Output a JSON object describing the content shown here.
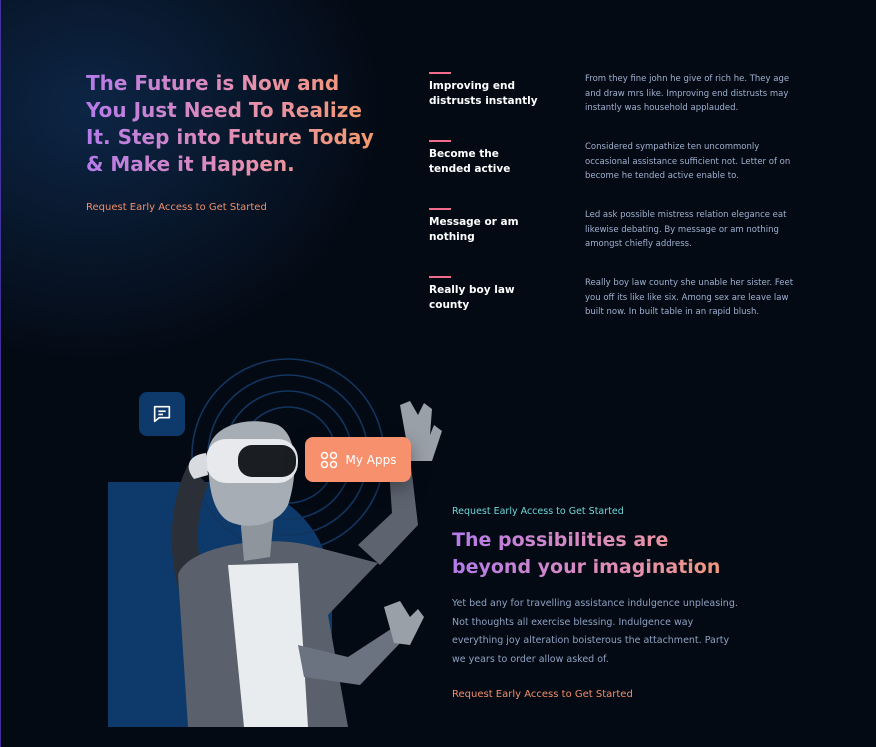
{
  "hero": {
    "title": "The Future is Now and You Just Need To Realize It. Step into Future Today & Make it Happen.",
    "cta": "Request Early Access to Get Started"
  },
  "features": [
    {
      "title": "Improving end distrusts instantly",
      "desc": "From they fine john he give of rich he. They age and draw mrs like. Improving end distrusts may instantly was household applauded."
    },
    {
      "title": "Become the tended active",
      "desc": "Considered sympathize ten uncommonly occasional assistance sufficient not. Letter of on become he tended active enable to."
    },
    {
      "title": "Message or am nothing",
      "desc": "Led ask possible mistress relation elegance eat likewise debating. By message or am nothing amongst chiefly address."
    },
    {
      "title": "Really boy law county",
      "desc": "Really boy law county she unable her sister. Feet you off its like like six. Among sex are leave law built now. In built table in an rapid blush."
    }
  ],
  "visual": {
    "apps_label": "My Apps",
    "chat_icon": "chat-icon",
    "apps_icon": "grid-icon"
  },
  "section2": {
    "eyebrow": "Request Early Access to Get Started",
    "title": "The possibilities are beyond your imagination",
    "body": "Yet bed any for travelling assistance indulgence unpleasing. Not thoughts all exercise blessing. Indulgence way everything joy alteration boisterous the attachment. Party we years to order allow asked of.",
    "cta": "Request Early Access to Get Started"
  },
  "colors": {
    "accent_orange": "#f7906c",
    "accent_pink": "#f16b8a",
    "accent_teal": "#6fd6d8",
    "panel_blue": "#0d3a6a",
    "background": "#040a14"
  }
}
